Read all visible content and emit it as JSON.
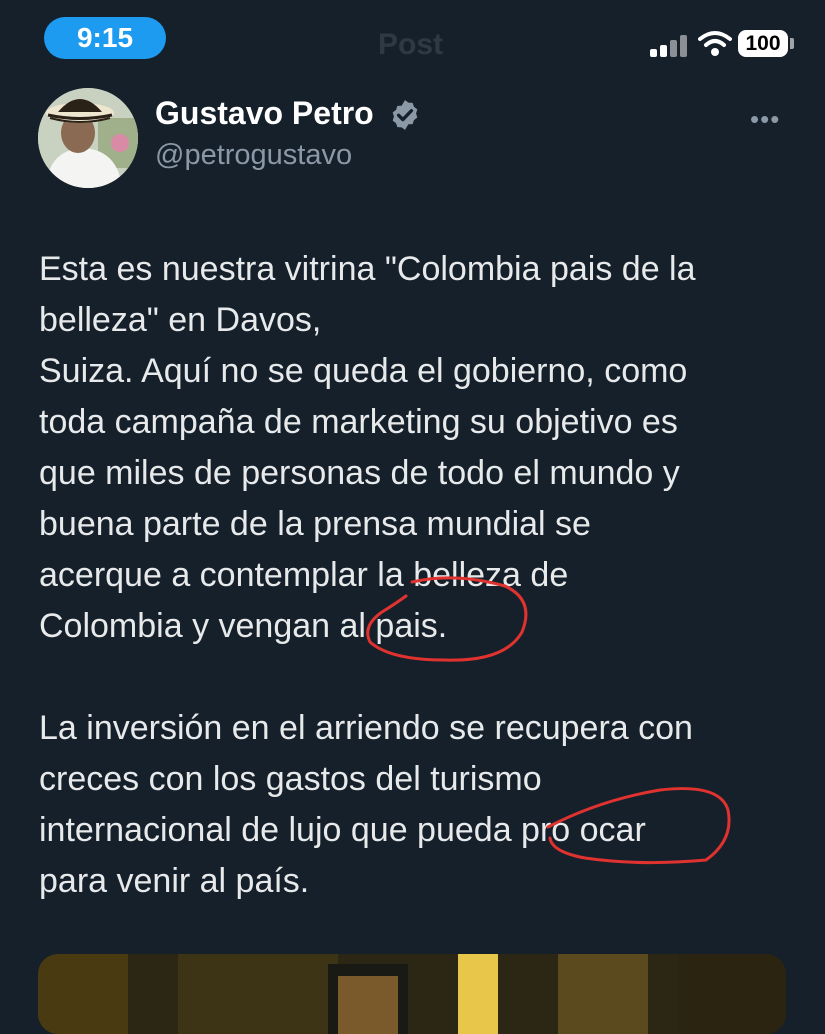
{
  "status_bar": {
    "time": "9:15",
    "battery": "100",
    "icons": [
      "cellular-signal-icon",
      "wifi-icon",
      "battery-icon"
    ]
  },
  "header": {
    "title": "Post"
  },
  "author": {
    "name": "Gustavo Petro",
    "handle": "@petrogustavo",
    "verified": true
  },
  "tweet": {
    "lines_p1": [
      "Esta es nuestra vitrina \"Colombia pais de la",
      "belleza\" en Davos,",
      "Suiza. Aquí no se queda el gobierno, como",
      "toda campaña de marketing su objetivo es",
      "que miles de personas de todo el mundo y",
      "buena parte de la prensa mundial se",
      "acerque a contemplar la belleza de",
      "Colombia y vengan al pais."
    ],
    "lines_p2": [
      "La inversión en el arriendo se recupera con",
      "creces con los gastos del turismo",
      "internacional de lujo que pueda pro ocar",
      "para venir al país."
    ]
  },
  "colors": {
    "background": "#15202b",
    "accent": "#1d9bf0",
    "text": "#e7e9ea",
    "muted": "#8b98a5",
    "annotation": "#e0322f"
  }
}
